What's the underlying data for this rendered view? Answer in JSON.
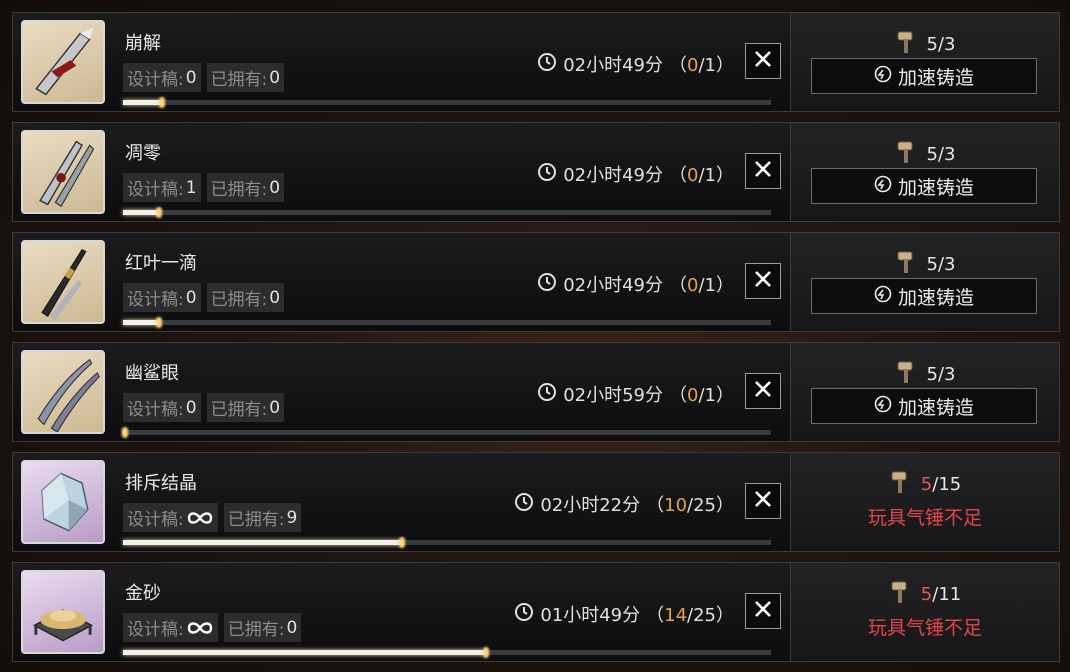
{
  "rows": [
    {
      "name": "崩解",
      "blueprint_label": "设计稿:",
      "blueprint_value": "0",
      "owned_label": "已拥有:",
      "owned_value": "0",
      "time": "02小时49分",
      "progress_open": "（",
      "progress_cur": "0",
      "progress_total": "/1）",
      "bar_fraction": 0.06,
      "cost_have": "5",
      "cost_sep": "/",
      "cost_need": "3",
      "action_label": "加速铸造",
      "icon": "weapon-icon"
    },
    {
      "name": "凋零",
      "blueprint_label": "设计稿:",
      "blueprint_value": "1",
      "owned_label": "已拥有:",
      "owned_value": "0",
      "time": "02小时49分",
      "progress_open": "（",
      "progress_cur": "0",
      "progress_total": "/1）",
      "bar_fraction": 0.055,
      "cost_have": "5",
      "cost_sep": "/",
      "cost_need": "3",
      "action_label": "加速铸造",
      "icon": "weapon-icon"
    },
    {
      "name": "红叶一滴",
      "blueprint_label": "设计稿:",
      "blueprint_value": "0",
      "owned_label": "已拥有:",
      "owned_value": "0",
      "time": "02小时49分",
      "progress_open": "（",
      "progress_cur": "0",
      "progress_total": "/1）",
      "bar_fraction": 0.055,
      "cost_have": "5",
      "cost_sep": "/",
      "cost_need": "3",
      "action_label": "加速铸造",
      "icon": "weapon-icon"
    },
    {
      "name": "幽鲨眼",
      "blueprint_label": "设计稿:",
      "blueprint_value": "0",
      "owned_label": "已拥有:",
      "owned_value": "0",
      "time": "02小时59分",
      "progress_open": "（",
      "progress_cur": "0",
      "progress_total": "/1）",
      "bar_fraction": 0.003,
      "cost_have": "5",
      "cost_sep": "/",
      "cost_need": "3",
      "action_label": "加速铸造",
      "icon": "weapon-icon"
    },
    {
      "name": "排斥结晶",
      "blueprint_label": "设计稿:",
      "blueprint_value": "",
      "owned_label": "已拥有:",
      "owned_value": "9",
      "time": "02小时22分",
      "progress_open": "（",
      "progress_cur": "10",
      "progress_total": "/25）",
      "bar_fraction": 0.43,
      "cost_have": "5",
      "cost_sep": "/",
      "cost_need": "15",
      "warning": "玩具气锤不足",
      "icon": "crystal-icon"
    },
    {
      "name": "金砂",
      "blueprint_label": "设计稿:",
      "blueprint_value": "",
      "owned_label": "已拥有:",
      "owned_value": "0",
      "time": "01小时49分",
      "progress_open": "（",
      "progress_cur": "14",
      "progress_total": "/25）",
      "bar_fraction": 0.56,
      "cost_have": "5",
      "cost_sep": "/",
      "cost_need": "11",
      "warning": "玩具气锤不足",
      "icon": "gold-sand-icon"
    }
  ],
  "colors": {
    "accent_orange": "#e4a34a",
    "warning_red": "#e0464a"
  }
}
